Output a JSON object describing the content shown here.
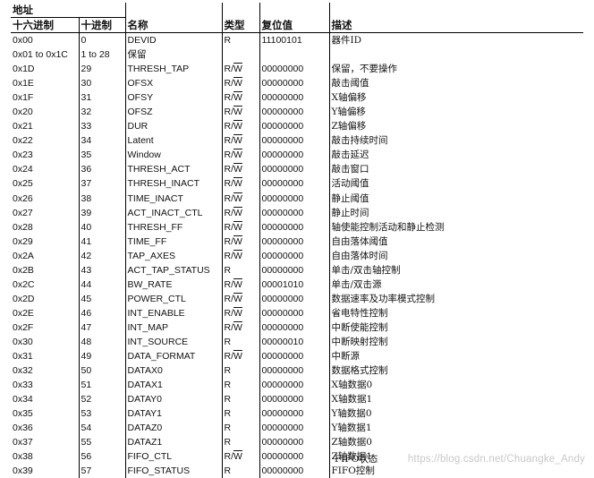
{
  "header": {
    "addr_group": "地址",
    "hex": "十六进制",
    "dec": "十进制",
    "name": "名称",
    "type": "类型",
    "reset": "复位值",
    "desc": "描述"
  },
  "rows": [
    {
      "hex": "0x00",
      "dec": "0",
      "name": "DEVID",
      "type": "R",
      "reset": "11100101",
      "desc": "器件ID"
    },
    {
      "hex": "0x01 to 0x1C",
      "dec": "1 to 28",
      "name": "保留",
      "type": "",
      "reset": "",
      "desc": ""
    },
    {
      "hex": "0x1D",
      "dec": "29",
      "name": "THRESH_TAP",
      "type": "R/W",
      "reset": "00000000",
      "desc": "保留，不要操作"
    },
    {
      "hex": "0x1E",
      "dec": "30",
      "name": "OFSX",
      "type": "R/W",
      "reset": "00000000",
      "desc": "敲击阈值"
    },
    {
      "hex": "0x1F",
      "dec": "31",
      "name": "OFSY",
      "type": "R/W",
      "reset": "00000000",
      "desc": "X轴偏移"
    },
    {
      "hex": "0x20",
      "dec": "32",
      "name": "OFSZ",
      "type": "R/W",
      "reset": "00000000",
      "desc": "Y轴偏移"
    },
    {
      "hex": "0x21",
      "dec": "33",
      "name": "DUR",
      "type": "R/W",
      "reset": "00000000",
      "desc": "Z轴偏移"
    },
    {
      "hex": "0x22",
      "dec": "34",
      "name": "Latent",
      "type": "R/W",
      "reset": "00000000",
      "desc": "敲击持续时间"
    },
    {
      "hex": "0x23",
      "dec": "35",
      "name": "Window",
      "type": "R/W",
      "reset": "00000000",
      "desc": "敲击延迟"
    },
    {
      "hex": "0x24",
      "dec": "36",
      "name": "THRESH_ACT",
      "type": "R/W",
      "reset": "00000000",
      "desc": "敲击窗口"
    },
    {
      "hex": "0x25",
      "dec": "37",
      "name": "THRESH_INACT",
      "type": "R/W",
      "reset": "00000000",
      "desc": "活动阈值"
    },
    {
      "hex": "0x26",
      "dec": "38",
      "name": "TIME_INACT",
      "type": "R/W",
      "reset": "00000000",
      "desc": "静止阈值"
    },
    {
      "hex": "0x27",
      "dec": "39",
      "name": "ACT_INACT_CTL",
      "type": "R/W",
      "reset": "00000000",
      "desc": "静止时间"
    },
    {
      "hex": "0x28",
      "dec": "40",
      "name": "THRESH_FF",
      "type": "R/W",
      "reset": "00000000",
      "desc": "轴使能控制活动和静止检测"
    },
    {
      "hex": "0x29",
      "dec": "41",
      "name": "TIME_FF",
      "type": "R/W",
      "reset": "00000000",
      "desc": "自由落体阈值"
    },
    {
      "hex": "0x2A",
      "dec": "42",
      "name": "TAP_AXES",
      "type": "R/W",
      "reset": "00000000",
      "desc": "自由落体时间"
    },
    {
      "hex": "0x2B",
      "dec": "43",
      "name": "ACT_TAP_STATUS",
      "type": "R",
      "reset": "00000000",
      "desc": "单击/双击轴控制"
    },
    {
      "hex": "0x2C",
      "dec": "44",
      "name": "BW_RATE",
      "type": "R/W",
      "reset": "00001010",
      "desc": "单击/双击源"
    },
    {
      "hex": "0x2D",
      "dec": "45",
      "name": "POWER_CTL",
      "type": "R/W",
      "reset": "00000000",
      "desc": "数据速率及功率模式控制"
    },
    {
      "hex": "0x2E",
      "dec": "46",
      "name": "INT_ENABLE",
      "type": "R/W",
      "reset": "00000000",
      "desc": "省电特性控制"
    },
    {
      "hex": "0x2F",
      "dec": "47",
      "name": "INT_MAP",
      "type": "R/W",
      "reset": "00000000",
      "desc": "中断使能控制"
    },
    {
      "hex": "0x30",
      "dec": "48",
      "name": "INT_SOURCE",
      "type": "R",
      "reset": "00000010",
      "desc": "中断映射控制"
    },
    {
      "hex": "0x31",
      "dec": "49",
      "name": "DATA_FORMAT",
      "type": "R/W",
      "reset": "00000000",
      "desc": "中断源"
    },
    {
      "hex": "0x32",
      "dec": "50",
      "name": "DATAX0",
      "type": "R",
      "reset": "00000000",
      "desc": "数据格式控制"
    },
    {
      "hex": "0x33",
      "dec": "51",
      "name": "DATAX1",
      "type": "R",
      "reset": "00000000",
      "desc": "X轴数据0"
    },
    {
      "hex": "0x34",
      "dec": "52",
      "name": "DATAY0",
      "type": "R",
      "reset": "00000000",
      "desc": "X轴数据1"
    },
    {
      "hex": "0x35",
      "dec": "53",
      "name": "DATAY1",
      "type": "R",
      "reset": "00000000",
      "desc": "Y轴数据0"
    },
    {
      "hex": "0x36",
      "dec": "54",
      "name": "DATAZ0",
      "type": "R",
      "reset": "00000000",
      "desc": "Y轴数据1"
    },
    {
      "hex": "0x37",
      "dec": "55",
      "name": "DATAZ1",
      "type": "R",
      "reset": "00000000",
      "desc": "Z轴数据0"
    },
    {
      "hex": "0x38",
      "dec": "56",
      "name": "FIFO_CTL",
      "type": "R/W",
      "reset": "00000000",
      "desc": "Z轴数据1"
    },
    {
      "hex": "0x39",
      "dec": "57",
      "name": "FIFO_STATUS",
      "type": "R",
      "reset": "00000000",
      "desc": "FIFO控制"
    }
  ],
  "watermark": "https://blog.csdn.net/Chuangke_Andy",
  "overlap_text": "FIFO状态"
}
